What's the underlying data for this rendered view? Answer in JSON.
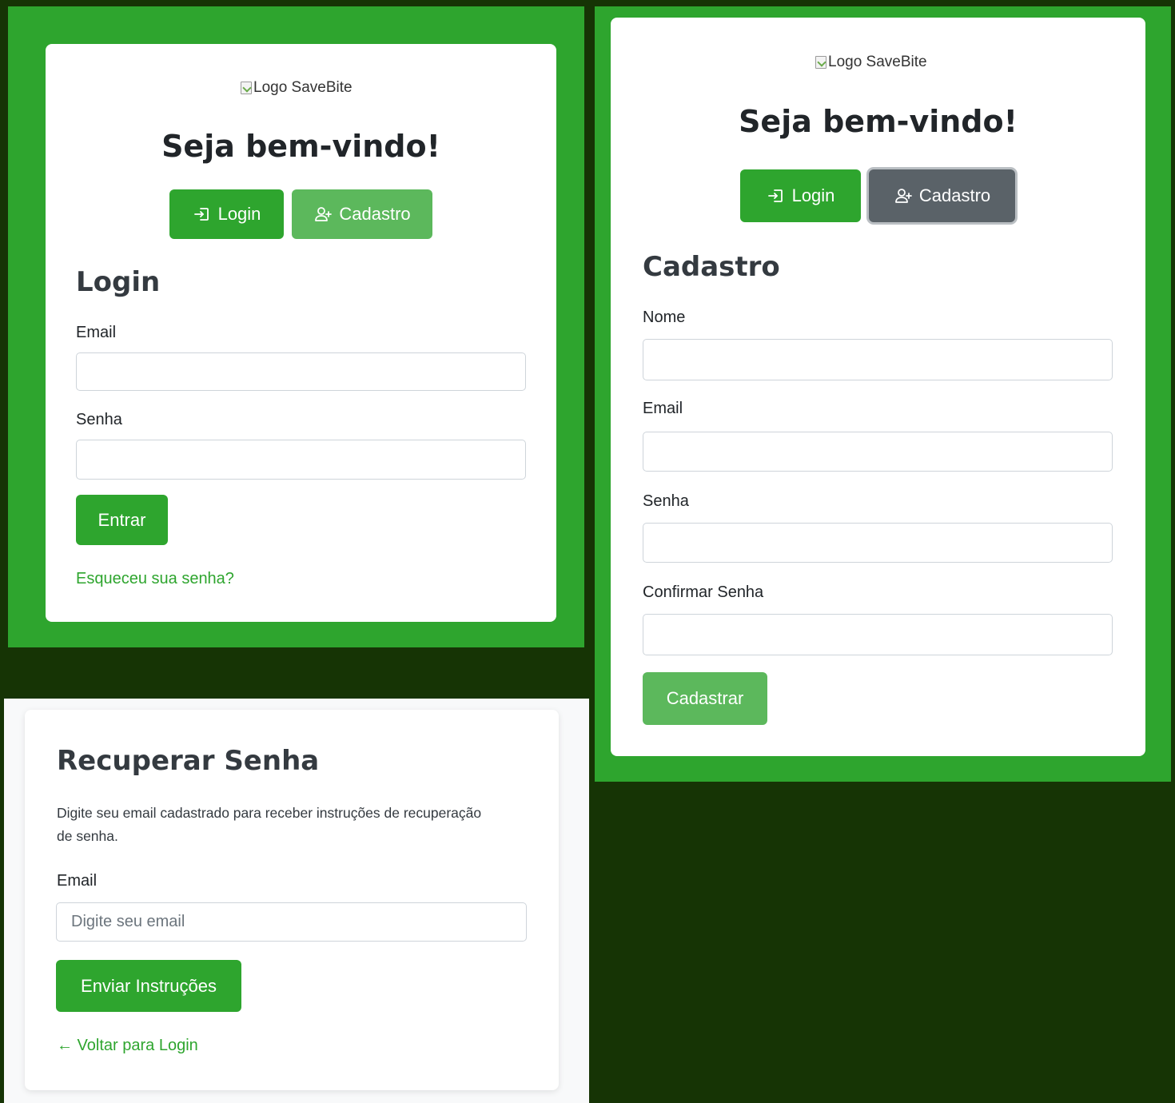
{
  "login_panel": {
    "logo_alt": "Logo SaveBite",
    "welcome": "Seja bem-vindo!",
    "tabs": {
      "login": "Login",
      "cadastro": "Cadastro"
    },
    "form_title": "Login",
    "email_label": "Email",
    "password_label": "Senha",
    "submit_label": "Entrar",
    "forgot_link": "Esqueceu sua senha?"
  },
  "register_panel": {
    "logo_alt": "Logo SaveBite",
    "welcome": "Seja bem-vindo!",
    "tabs": {
      "login": "Login",
      "cadastro": "Cadastro"
    },
    "form_title": "Cadastro",
    "name_label": "Nome",
    "email_label": "Email",
    "password_label": "Senha",
    "confirm_label": "Confirmar Senha",
    "submit_label": "Cadastrar"
  },
  "recover_panel": {
    "title": "Recuperar Senha",
    "description_line1": "Digite seu email cadastrado para receber instruções de recuperação",
    "description_line2": "de senha.",
    "email_label": "Email",
    "email_placeholder": "Digite seu email",
    "submit_label": "Enviar Instruções",
    "back_link": "← Voltar para Login"
  },
  "colors": {
    "primary_green": "#2ea52e",
    "light_green": "#5cb85c",
    "dark_background": "#163405",
    "active_tab_gray": "#5a6268"
  },
  "icons": [
    "login-icon",
    "add-user-icon",
    "broken-image-icon"
  ]
}
